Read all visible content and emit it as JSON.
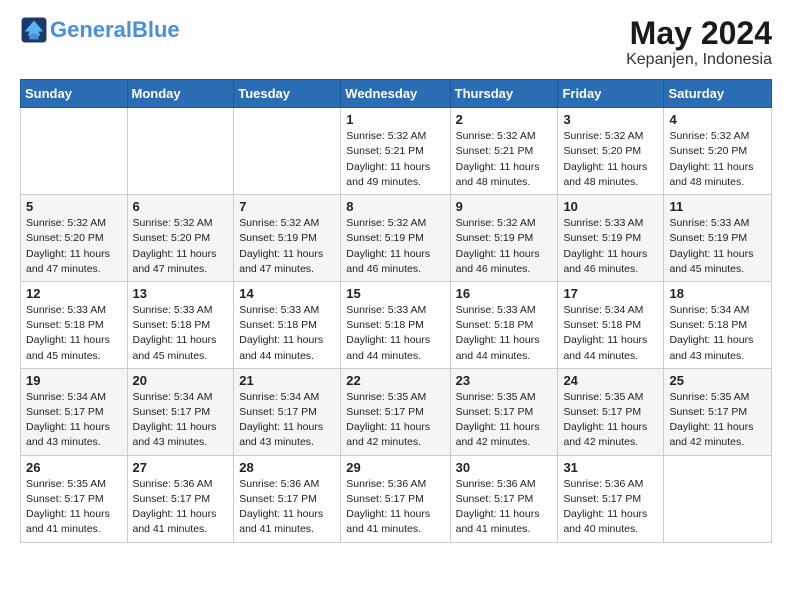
{
  "header": {
    "logo_line1": "General",
    "logo_line2": "Blue",
    "month": "May 2024",
    "location": "Kepanjen, Indonesia"
  },
  "days_of_week": [
    "Sunday",
    "Monday",
    "Tuesday",
    "Wednesday",
    "Thursday",
    "Friday",
    "Saturday"
  ],
  "weeks": [
    [
      {
        "num": "",
        "info": ""
      },
      {
        "num": "",
        "info": ""
      },
      {
        "num": "",
        "info": ""
      },
      {
        "num": "1",
        "info": "Sunrise: 5:32 AM\nSunset: 5:21 PM\nDaylight: 11 hours\nand 49 minutes."
      },
      {
        "num": "2",
        "info": "Sunrise: 5:32 AM\nSunset: 5:21 PM\nDaylight: 11 hours\nand 48 minutes."
      },
      {
        "num": "3",
        "info": "Sunrise: 5:32 AM\nSunset: 5:20 PM\nDaylight: 11 hours\nand 48 minutes."
      },
      {
        "num": "4",
        "info": "Sunrise: 5:32 AM\nSunset: 5:20 PM\nDaylight: 11 hours\nand 48 minutes."
      }
    ],
    [
      {
        "num": "5",
        "info": "Sunrise: 5:32 AM\nSunset: 5:20 PM\nDaylight: 11 hours\nand 47 minutes."
      },
      {
        "num": "6",
        "info": "Sunrise: 5:32 AM\nSunset: 5:20 PM\nDaylight: 11 hours\nand 47 minutes."
      },
      {
        "num": "7",
        "info": "Sunrise: 5:32 AM\nSunset: 5:19 PM\nDaylight: 11 hours\nand 47 minutes."
      },
      {
        "num": "8",
        "info": "Sunrise: 5:32 AM\nSunset: 5:19 PM\nDaylight: 11 hours\nand 46 minutes."
      },
      {
        "num": "9",
        "info": "Sunrise: 5:32 AM\nSunset: 5:19 PM\nDaylight: 11 hours\nand 46 minutes."
      },
      {
        "num": "10",
        "info": "Sunrise: 5:33 AM\nSunset: 5:19 PM\nDaylight: 11 hours\nand 46 minutes."
      },
      {
        "num": "11",
        "info": "Sunrise: 5:33 AM\nSunset: 5:19 PM\nDaylight: 11 hours\nand 45 minutes."
      }
    ],
    [
      {
        "num": "12",
        "info": "Sunrise: 5:33 AM\nSunset: 5:18 PM\nDaylight: 11 hours\nand 45 minutes."
      },
      {
        "num": "13",
        "info": "Sunrise: 5:33 AM\nSunset: 5:18 PM\nDaylight: 11 hours\nand 45 minutes."
      },
      {
        "num": "14",
        "info": "Sunrise: 5:33 AM\nSunset: 5:18 PM\nDaylight: 11 hours\nand 44 minutes."
      },
      {
        "num": "15",
        "info": "Sunrise: 5:33 AM\nSunset: 5:18 PM\nDaylight: 11 hours\nand 44 minutes."
      },
      {
        "num": "16",
        "info": "Sunrise: 5:33 AM\nSunset: 5:18 PM\nDaylight: 11 hours\nand 44 minutes."
      },
      {
        "num": "17",
        "info": "Sunrise: 5:34 AM\nSunset: 5:18 PM\nDaylight: 11 hours\nand 44 minutes."
      },
      {
        "num": "18",
        "info": "Sunrise: 5:34 AM\nSunset: 5:18 PM\nDaylight: 11 hours\nand 43 minutes."
      }
    ],
    [
      {
        "num": "19",
        "info": "Sunrise: 5:34 AM\nSunset: 5:17 PM\nDaylight: 11 hours\nand 43 minutes."
      },
      {
        "num": "20",
        "info": "Sunrise: 5:34 AM\nSunset: 5:17 PM\nDaylight: 11 hours\nand 43 minutes."
      },
      {
        "num": "21",
        "info": "Sunrise: 5:34 AM\nSunset: 5:17 PM\nDaylight: 11 hours\nand 43 minutes."
      },
      {
        "num": "22",
        "info": "Sunrise: 5:35 AM\nSunset: 5:17 PM\nDaylight: 11 hours\nand 42 minutes."
      },
      {
        "num": "23",
        "info": "Sunrise: 5:35 AM\nSunset: 5:17 PM\nDaylight: 11 hours\nand 42 minutes."
      },
      {
        "num": "24",
        "info": "Sunrise: 5:35 AM\nSunset: 5:17 PM\nDaylight: 11 hours\nand 42 minutes."
      },
      {
        "num": "25",
        "info": "Sunrise: 5:35 AM\nSunset: 5:17 PM\nDaylight: 11 hours\nand 42 minutes."
      }
    ],
    [
      {
        "num": "26",
        "info": "Sunrise: 5:35 AM\nSunset: 5:17 PM\nDaylight: 11 hours\nand 41 minutes."
      },
      {
        "num": "27",
        "info": "Sunrise: 5:36 AM\nSunset: 5:17 PM\nDaylight: 11 hours\nand 41 minutes."
      },
      {
        "num": "28",
        "info": "Sunrise: 5:36 AM\nSunset: 5:17 PM\nDaylight: 11 hours\nand 41 minutes."
      },
      {
        "num": "29",
        "info": "Sunrise: 5:36 AM\nSunset: 5:17 PM\nDaylight: 11 hours\nand 41 minutes."
      },
      {
        "num": "30",
        "info": "Sunrise: 5:36 AM\nSunset: 5:17 PM\nDaylight: 11 hours\nand 41 minutes."
      },
      {
        "num": "31",
        "info": "Sunrise: 5:36 AM\nSunset: 5:17 PM\nDaylight: 11 hours\nand 40 minutes."
      },
      {
        "num": "",
        "info": ""
      }
    ]
  ]
}
